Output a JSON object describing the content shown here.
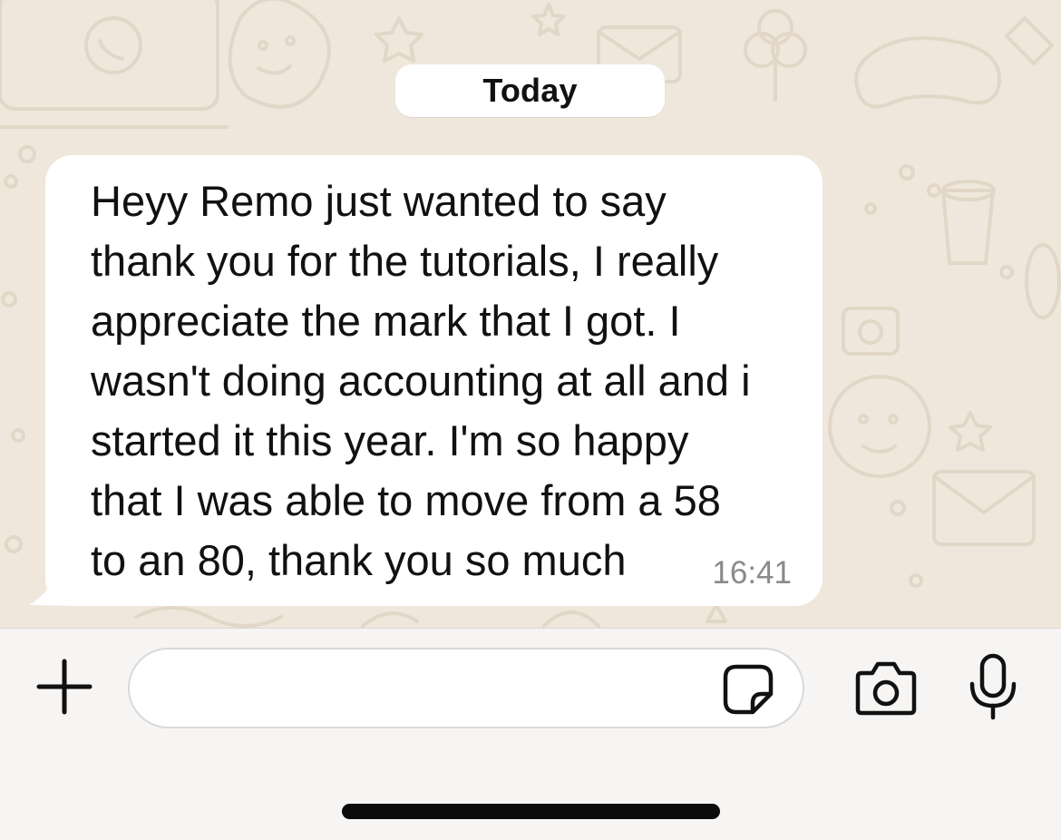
{
  "chat": {
    "date_separator": "Today",
    "messages": [
      {
        "direction": "incoming",
        "text": "Heyy Remo just wanted to say\nthank you for the tutorials, I really\nappreciate the mark that I got. I\nwasn't doing accounting at all and i\nstarted it this year. I'm so happy\nthat I was able to move from a 58\nto an 80, thank you so much",
        "time": "16:41"
      }
    ]
  },
  "composer": {
    "placeholder": "",
    "value": "",
    "icons": {
      "attach": "plus-icon",
      "sticker": "sticker-icon",
      "camera": "camera-icon",
      "voice": "microphone-icon"
    }
  },
  "colors": {
    "wallpaper": "#efe7dc",
    "wallpaper_doodle": "#e4d9ca",
    "bubble": "#ffffff",
    "timestamp": "#8a8a8a",
    "composer_bg": "#f6f5f4"
  }
}
